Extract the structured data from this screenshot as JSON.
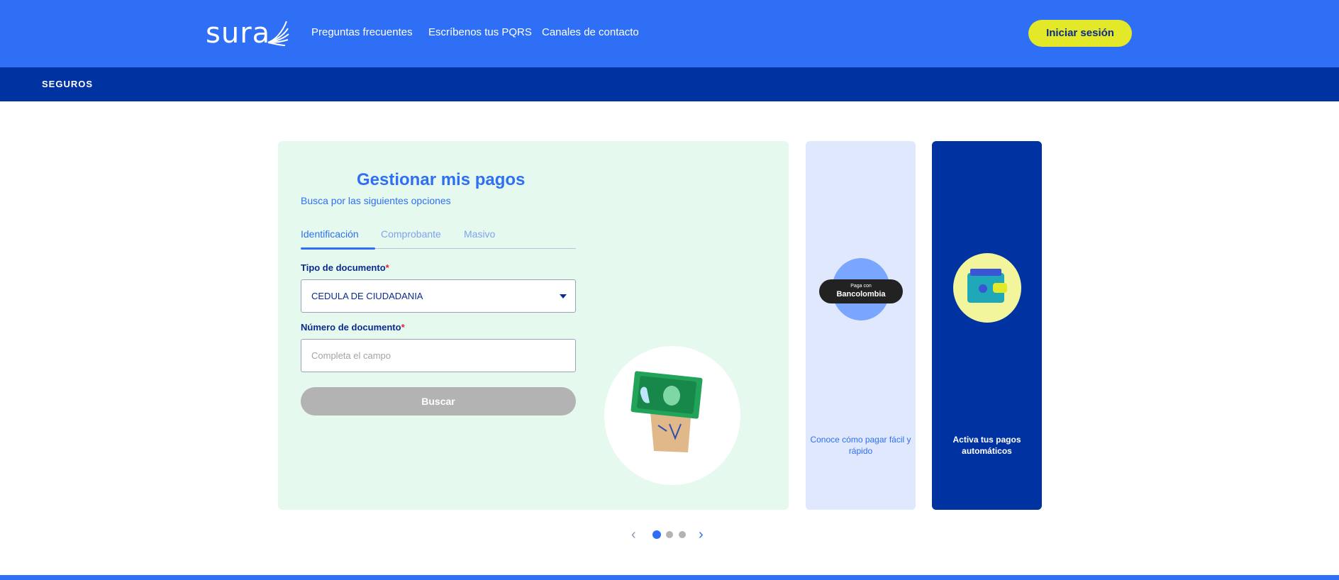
{
  "header": {
    "logo_text": "sura",
    "nav": [
      "Preguntas frecuentes",
      "Escríbenos tus PQRS",
      "Canales de contacto"
    ],
    "login_label": "Iniciar sesión"
  },
  "subbar": {
    "label": "SEGUROS"
  },
  "payments": {
    "title": "Gestionar mis pagos",
    "subtitle": "Busca por las siguientes opciones",
    "tabs": [
      {
        "label": "Identificación",
        "active": true
      },
      {
        "label": "Comprobante",
        "active": false
      },
      {
        "label": "Masivo",
        "active": false
      }
    ],
    "doc_type_label": "Tipo de documento",
    "doc_type_value": "CEDULA DE CIUDADANIA",
    "doc_number_label": "Número de documento",
    "doc_number_placeholder": "Completa el campo",
    "required_mark": "*",
    "search_label": "Buscar"
  },
  "side_cards": [
    {
      "badge_small": "Paga con",
      "badge_big": "Bancolombia",
      "text": "Conoce cómo pagar fácil y rápido"
    },
    {
      "text": "Activa tus pagos automáticos"
    }
  ],
  "pager": {
    "prev": "‹",
    "next": "›",
    "total": 3,
    "current": 1
  },
  "colors": {
    "primary": "#2e6ff5",
    "dark_blue": "#0033a1",
    "accent_yellow": "#e3e829",
    "card_green": "#e6f9ee",
    "disabled_gray": "#b3b3b3"
  }
}
